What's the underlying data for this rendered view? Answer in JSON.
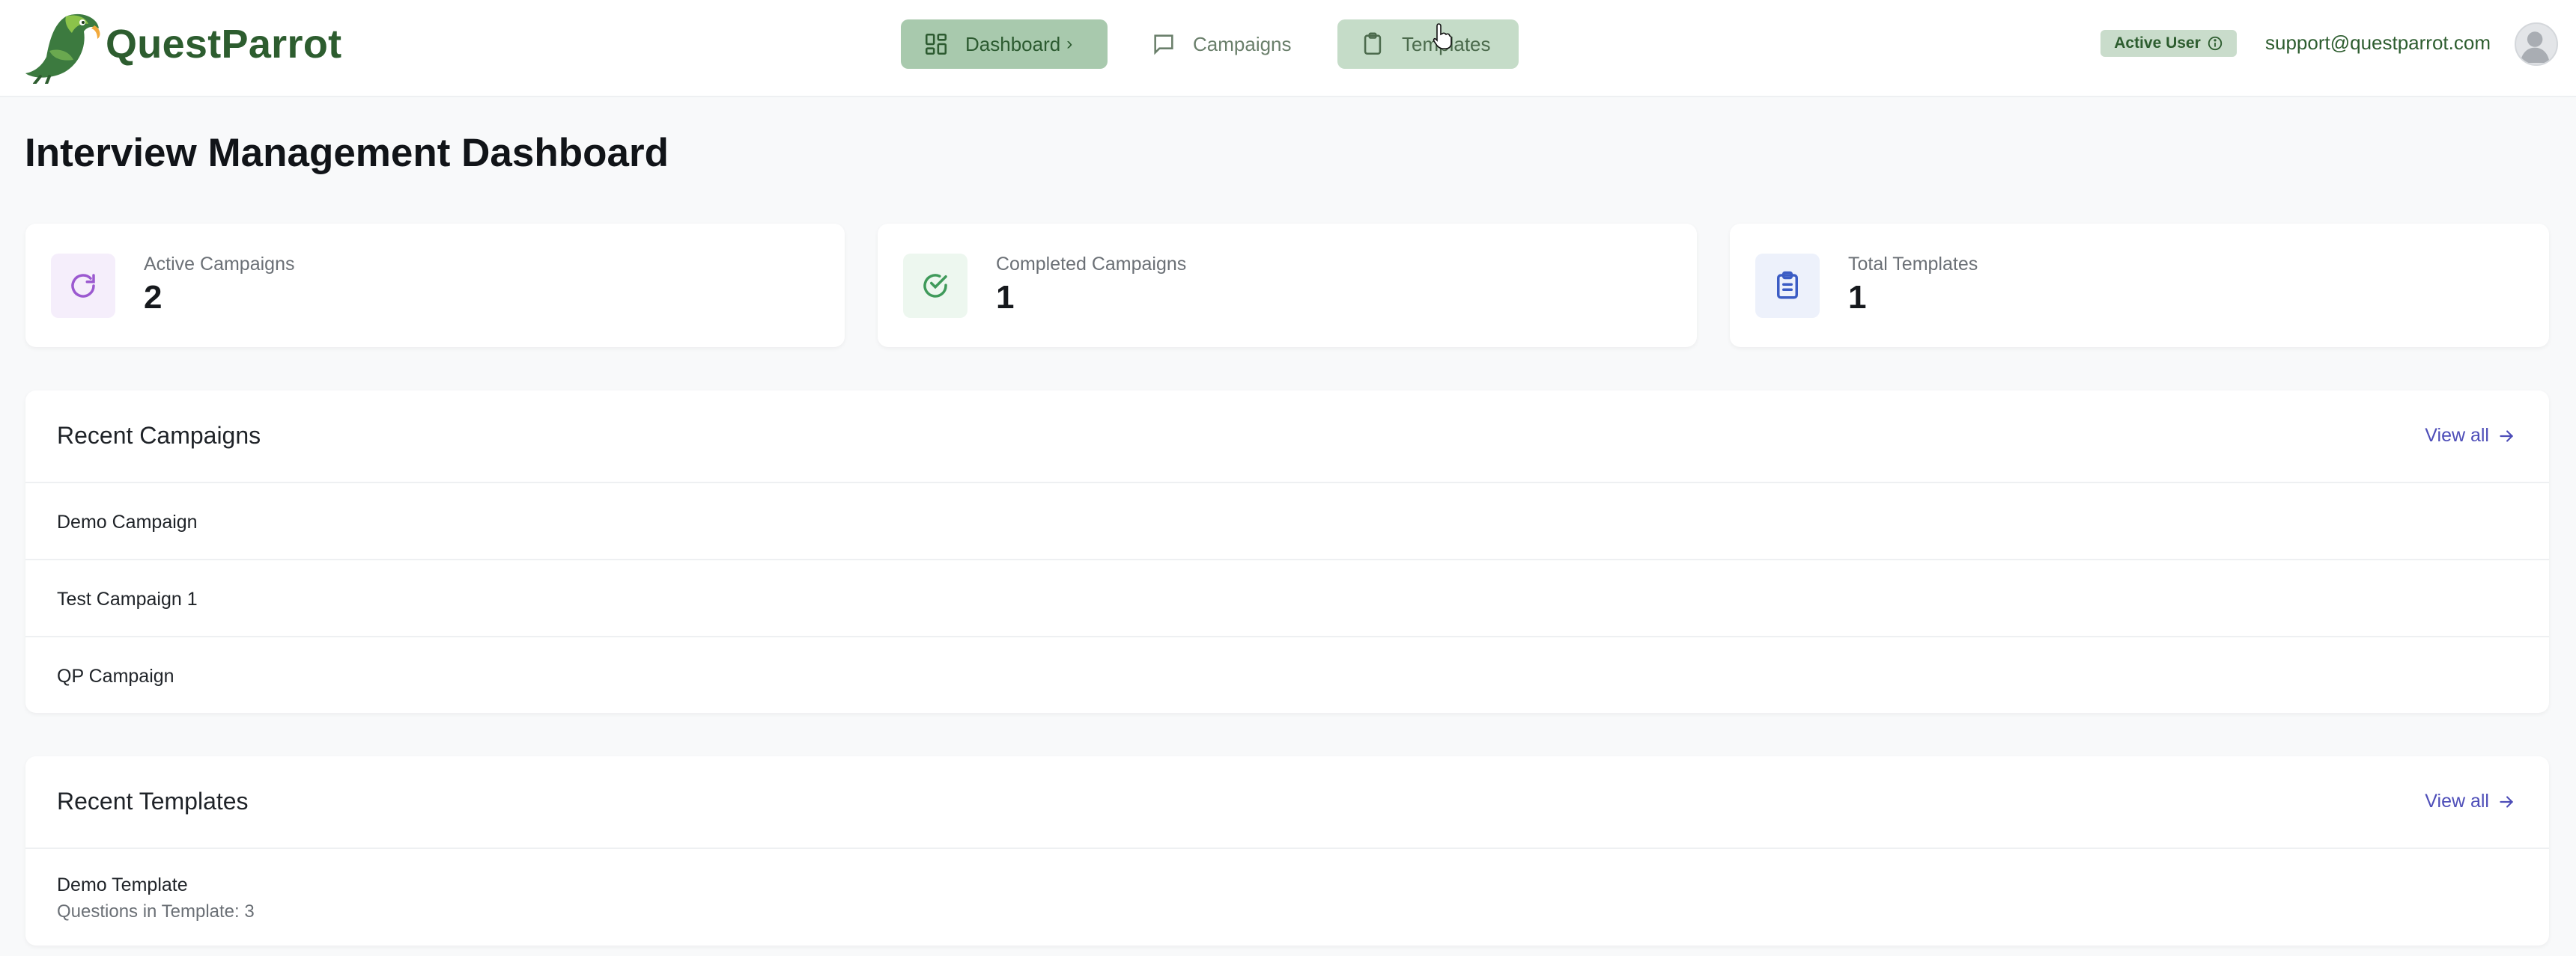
{
  "header": {
    "brand": "QuestParrot",
    "nav": {
      "dashboard": "Dashboard",
      "dashboard_suffix": "›",
      "campaigns": "Campaigns",
      "templates": "Templates"
    },
    "status_badge": "Active User",
    "email": "support@questparrot.com"
  },
  "page": {
    "title": "Interview Management Dashboard"
  },
  "stats": [
    {
      "label": "Active Campaigns",
      "value": "2",
      "icon": "refresh-icon",
      "color": "#9b59d0"
    },
    {
      "label": "Completed Campaigns",
      "value": "1",
      "icon": "check-circle-icon",
      "color": "#3f9a5a"
    },
    {
      "label": "Total Templates",
      "value": "1",
      "icon": "clipboard-icon",
      "color": "#3b5cc4"
    }
  ],
  "recent_campaigns": {
    "title": "Recent Campaigns",
    "view_all": "View all",
    "items": [
      "Demo Campaign",
      "Test Campaign 1",
      "QP Campaign"
    ]
  },
  "recent_templates": {
    "title": "Recent Templates",
    "view_all": "View all",
    "items": [
      {
        "name": "Demo Template",
        "meta": "Questions in Template: 3"
      }
    ]
  },
  "colors": {
    "brand_green": "#2d5d2f",
    "link": "#4d4db8"
  }
}
